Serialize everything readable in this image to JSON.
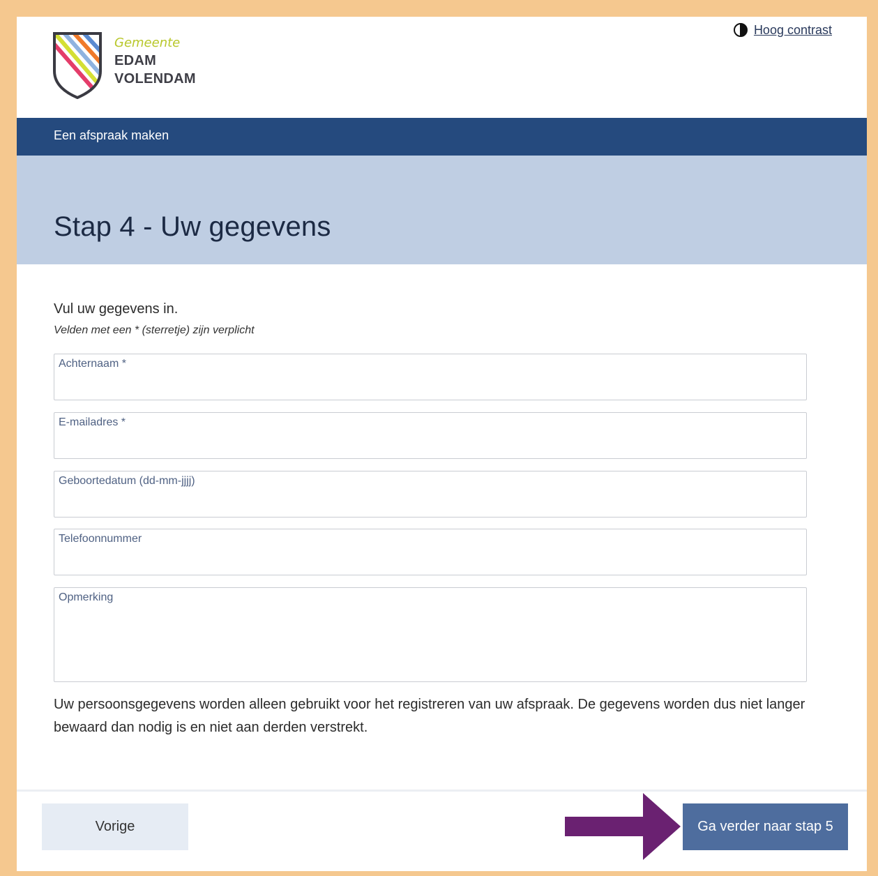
{
  "header": {
    "logo": {
      "line1": "Gemeente",
      "line2": "EDAM",
      "line3": "VOLENDAM"
    },
    "contrast_link": "Hoog contrast",
    "contrast_icon": "contrast-icon"
  },
  "navbar": {
    "title": "Een afspraak maken"
  },
  "page": {
    "title": "Stap 4 - Uw gegevens",
    "intro": "Vul uw gegevens in.",
    "hint": "Velden met een * (sterretje) zijn verplicht"
  },
  "form": {
    "fields": [
      {
        "label": "Achternaam *",
        "value": ""
      },
      {
        "label": "E-mailadres *",
        "value": ""
      },
      {
        "label": "Geboortedatum (dd-mm-jjjj)",
        "value": ""
      },
      {
        "label": "Telefoonnummer",
        "value": ""
      },
      {
        "label": "Opmerking",
        "value": ""
      }
    ]
  },
  "privacy_text": "Uw persoonsgegevens worden alleen gebruikt voor het registreren van uw afspraak. De gegevens worden dus niet langer bewaard dan nodig is en niet aan derden verstrekt.",
  "footer": {
    "prev_label": "Vorige",
    "next_label": "Ga verder naar stap 5"
  },
  "colors": {
    "outer_border": "#f5c88f",
    "navbar": "#254a7e",
    "title_band": "#bfcee3",
    "primary_button": "#4e6d9e",
    "secondary_button": "#e6ecf4",
    "annotation_arrow": "#6a2171",
    "logo_accent": "#b8c72a"
  }
}
